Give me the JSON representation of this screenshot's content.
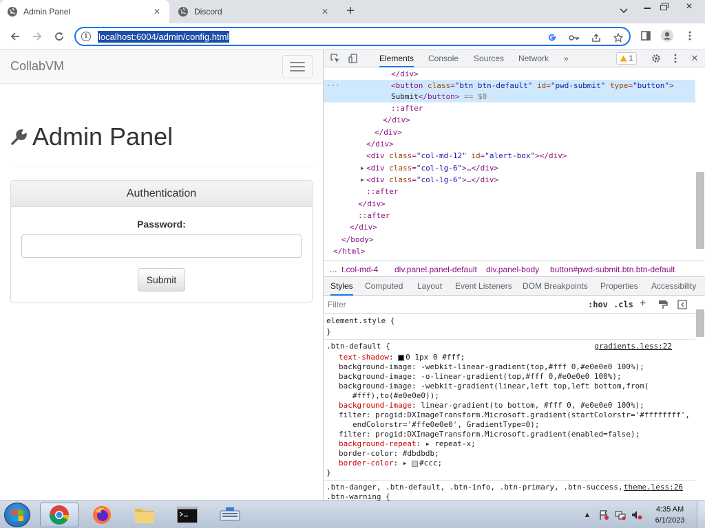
{
  "browser": {
    "tabs": [
      {
        "label": "Admin Panel",
        "active": true
      },
      {
        "label": "Discord",
        "active": false
      }
    ],
    "url": "localhost:6004/admin/config.html"
  },
  "page": {
    "brand": "CollabVM",
    "heading": "Admin Panel",
    "panel_title": "Authentication",
    "password_label": "Password:",
    "password_value": "",
    "submit_label": "Submit"
  },
  "devtools": {
    "tabs": [
      "Elements",
      "Console",
      "Sources",
      "Network"
    ],
    "more_tabs": "»",
    "warning_count": "1",
    "dom": {
      "l0": "</div>",
      "l1_tag_open": "<button",
      "l1_a1": "class",
      "l1_v1": "\"btn btn-default\"",
      "l1_a2": "id",
      "l1_v2": "\"pwd-submit\"",
      "l1_a3": "type",
      "l1_v3": "\"button\"",
      "l1_close": ">",
      "l2_text": "Submit",
      "l2_tag": "</button>",
      "l2_ref": "== $0",
      "l3": "::after",
      "l4": "</div>",
      "l5": "</div>",
      "l6": "</div>",
      "l7_open": "<div",
      "l7_a1": "class",
      "l7_v1": "\"col-md-12\"",
      "l7_a2": "id",
      "l7_v2": "\"alert-box\"",
      "l7_close": "></div>",
      "l8_open": "<div",
      "l8_a": "class",
      "l8_v": "\"col-lg-6\"",
      "l8_close": ">…</div>",
      "l9_open": "<div",
      "l9_a": "class",
      "l9_v": "\"col-lg-6\"",
      "l9_close": ">…</div>",
      "l10": "::after",
      "l11": "</div>",
      "l12": "::after",
      "l13": "</div>",
      "l14": "</body>",
      "l15": "</html>"
    },
    "breadcrumb": [
      "…",
      "t.col-md-4",
      "div.panel.panel-default",
      "div.panel-body",
      "button#pwd-submit.btn.btn-default"
    ],
    "style_tabs": [
      "Styles",
      "Computed",
      "Layout",
      "Event Listeners",
      "DOM Breakpoints",
      "Properties",
      "Accessibility"
    ],
    "filter_placeholder": "Filter",
    "hov_label": ":hov",
    "cls_label": ".cls",
    "styles": {
      "element_style": "element.style {",
      "close": "}",
      "rule1_selector": ".btn-default {",
      "rule1_source": "gradients.less:22",
      "p1_name": "text-shadow",
      "p1_value": "0 1px 0 #fff;",
      "p2": "background-image: -webkit-linear-gradient(top,#fff 0,#e0e0e0 100%);",
      "p3": "background-image: -o-linear-gradient(top,#fff 0,#e0e0e0 100%);",
      "p4a": "background-image: -webkit-gradient(linear,left top,left bottom,from(",
      "p4b": "#fff),to(#e0e0e0));",
      "p5_name": "background-image",
      "p5_value": "linear-gradient(to bottom, #fff 0, #e0e0e0 100%);",
      "p6a": "filter: progid:DXImageTransform.Microsoft.gradient(startColorstr='#ffffffff',",
      "p6b": "endColorstr='#ffe0e0e0', GradientType=0);",
      "p7": "filter: progid:DXImageTransform.Microsoft.gradient(enabled=false);",
      "p8_name": "background-repeat",
      "p8_value": "repeat-x;",
      "p9": "border-color: #dbdbdb;",
      "p10_name": "border-color",
      "p10_value": "#ccc;",
      "rule2_selector": ".btn-danger, .btn-default, .btn-info, .btn-primary, .btn-success,",
      "rule2_selector_b": ".btn-warning {",
      "rule2_source": "theme.less:26"
    }
  },
  "taskbar": {
    "time": "4:35 AM",
    "date": "6/1/2023"
  },
  "colors": {
    "accent": "#1a73e8",
    "taskbar": "#c6d3e2"
  }
}
